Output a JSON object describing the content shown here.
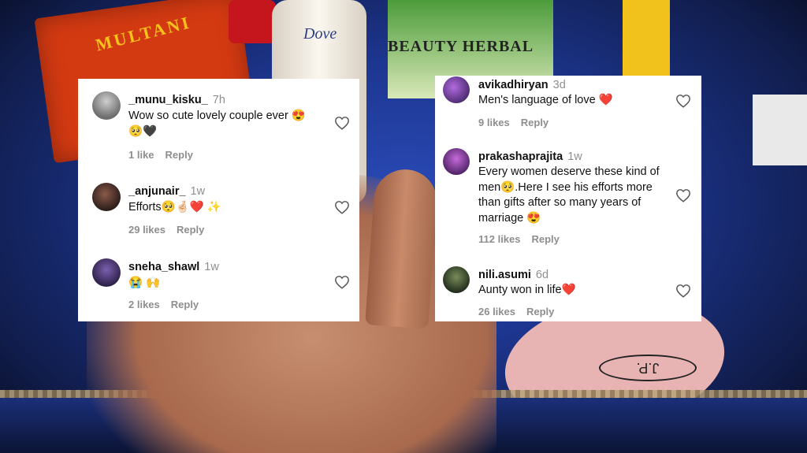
{
  "background": {
    "box_label": "MULTANI",
    "bottle_label": "Dove",
    "herbal_label": "BEAUTY HERBAL",
    "tag_label": "J.P."
  },
  "left_panel": {
    "comments": [
      {
        "username": "_munu_kisku_",
        "time": "7h",
        "text": "Wow so cute lovely couple ever 😍",
        "text_line2": "🥺🖤",
        "likes": "1 like",
        "reply": "Reply"
      },
      {
        "username": "_anjunair_",
        "time": "1w",
        "text": "Efforts🥺🤞🏻❤️ ✨",
        "likes": "29 likes",
        "reply": "Reply"
      },
      {
        "username": "sneha_shawl",
        "time": "1w",
        "text": "😭 🙌",
        "likes": "2 likes",
        "reply": "Reply"
      }
    ]
  },
  "right_panel": {
    "comments": [
      {
        "username": "avikadhiryan",
        "time": "3d",
        "text": "Men's language of love ❤️",
        "likes": "9 likes",
        "reply": "Reply"
      },
      {
        "username": "prakashaprajita",
        "time": "1w",
        "text_lines": [
          "Every women deserve these kind of",
          "men🥺.Here I see his efforts more",
          "than gifts after so many years of",
          "marriage 😍"
        ],
        "likes": "112 likes",
        "reply": "Reply"
      },
      {
        "username": "nili.asumi",
        "time": "6d",
        "text": "Aunty won in life❤️",
        "likes": "26 likes",
        "reply": "Reply"
      }
    ]
  },
  "icons": {
    "like": "heart-outline-icon"
  }
}
